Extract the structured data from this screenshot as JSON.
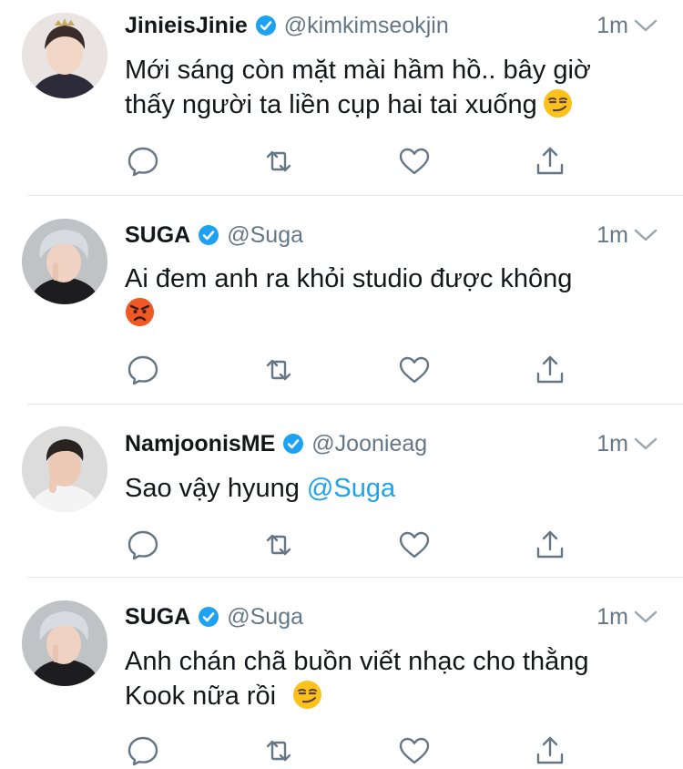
{
  "colors": {
    "link": "#1da1f2",
    "verified": "#1da1f2",
    "muted": "#657786",
    "text": "#14171a",
    "divider": "#e1e8ed"
  },
  "icons": {
    "reply": "reply-icon",
    "retweet": "retweet-icon",
    "like": "heart-icon",
    "share": "share-icon",
    "verified": "verified-badge-icon",
    "menu": "chevron-down-icon"
  },
  "tweets": [
    {
      "name": "JinieisJinie",
      "handle": "@kimkimseokjin",
      "time": "1m",
      "text_line1": "Mới sáng còn mặt mài hầm hồ.. bây giờ",
      "text_line2": "thấy người ta liền cụp hai tai xuống",
      "emoji": "smirking-face-emoji"
    },
    {
      "name": "SUGA",
      "handle": "@Suga",
      "time": "1m",
      "text_line1": "Ai đem anh ra khỏi studio được không",
      "emoji": "angry-face-emoji"
    },
    {
      "name": "NamjoonisME",
      "handle": "@Joonieag",
      "time": "1m",
      "text": "Sao vậy hyung",
      "mention": "@Suga"
    },
    {
      "name": "SUGA",
      "handle": "@Suga",
      "time": "1m",
      "text_line1": "Anh chán chã buồn viết nhạc cho thằng",
      "text_line2": "Kook nữa rồi",
      "emoji": "smirking-face-emoji"
    }
  ]
}
